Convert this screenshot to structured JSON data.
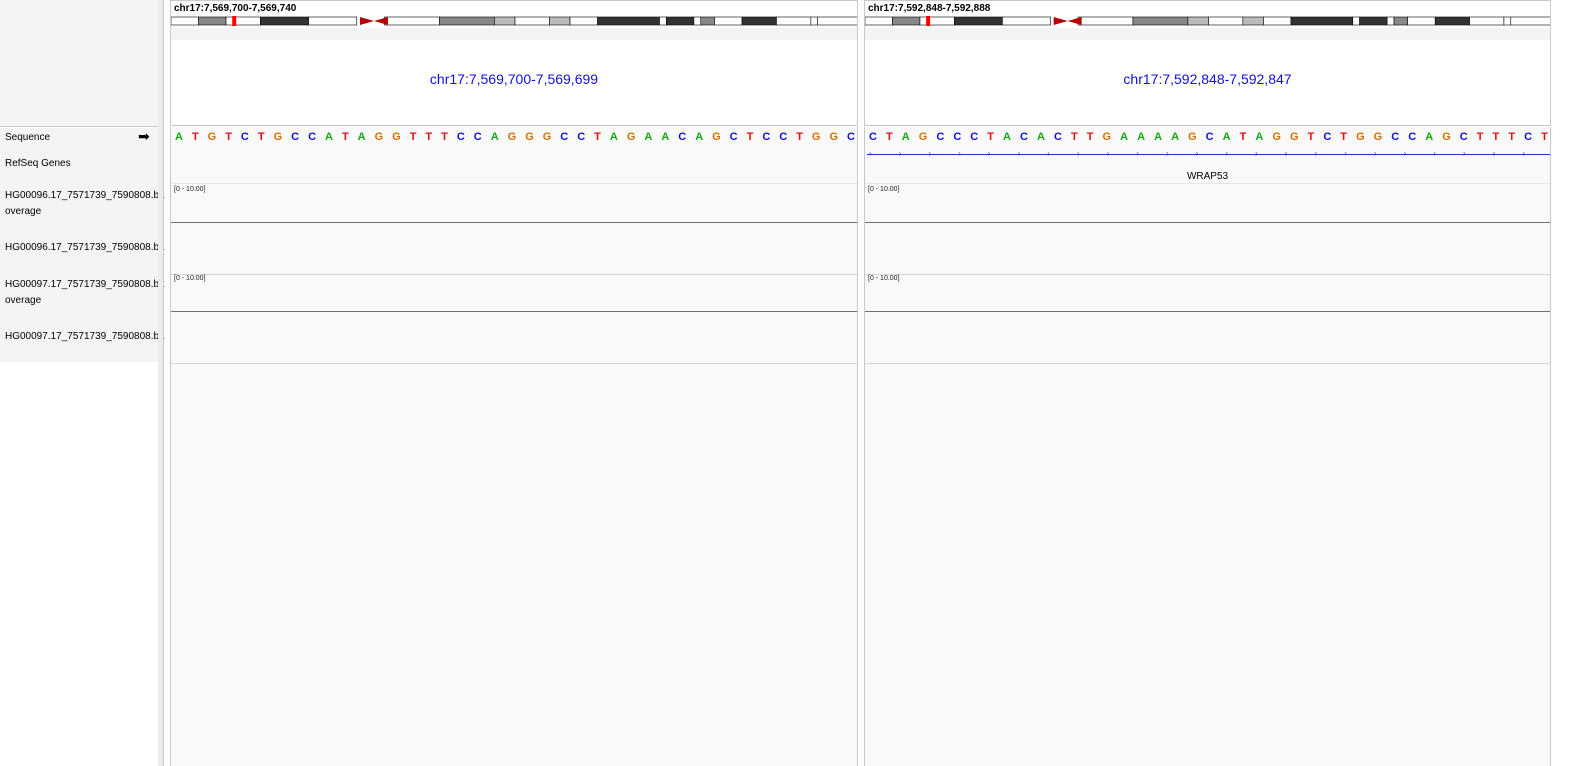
{
  "tracks": {
    "sequence": "Sequence",
    "refseq": "RefSeq Genes",
    "hg96_cov_line1": "HG00096.17_7571739_7590808.ba",
    "hg96_cov_line2": "overage",
    "hg96_reads": "HG00096.17_7571739_7590808.ba",
    "hg97_cov_line1": "HG00097.17_7571739_7590808.ba",
    "hg97_cov_line2": "overage",
    "hg97_reads": "HG00097.17_7571739_7590808.ba"
  },
  "icons": {
    "strand_arrow": "right-arrow-icon"
  },
  "colors": {
    "A": "#15a615",
    "C": "#1010e0",
    "G": "#d17105",
    "T": "#e01010",
    "range_text": "#1010e0",
    "gene": "#2233cc"
  },
  "panels": [
    {
      "locus": "chr17:7,569,700-7,569,740",
      "range": "chr17:7,569,700-7,569,699",
      "sequence": "ATGTCTGCCATAGGTTTCCAGGGCCTAGAACAGCTCCTGGC",
      "cov_scale_1": "[0 - 10.00]",
      "cov_scale_2": "[0 - 10.00]",
      "gene": ""
    },
    {
      "locus": "chr17:7,592,848-7,592,888",
      "range": "chr17:7,592,848-7,592,847",
      "sequence": "CTAGCCCTACACTTGAAAAGCATAGGTCTGGCCAGCTTTCT",
      "cov_scale_1": "[0 - 10.00]",
      "cov_scale_2": "[0 - 10.00]",
      "gene": "WRAP53"
    }
  ]
}
